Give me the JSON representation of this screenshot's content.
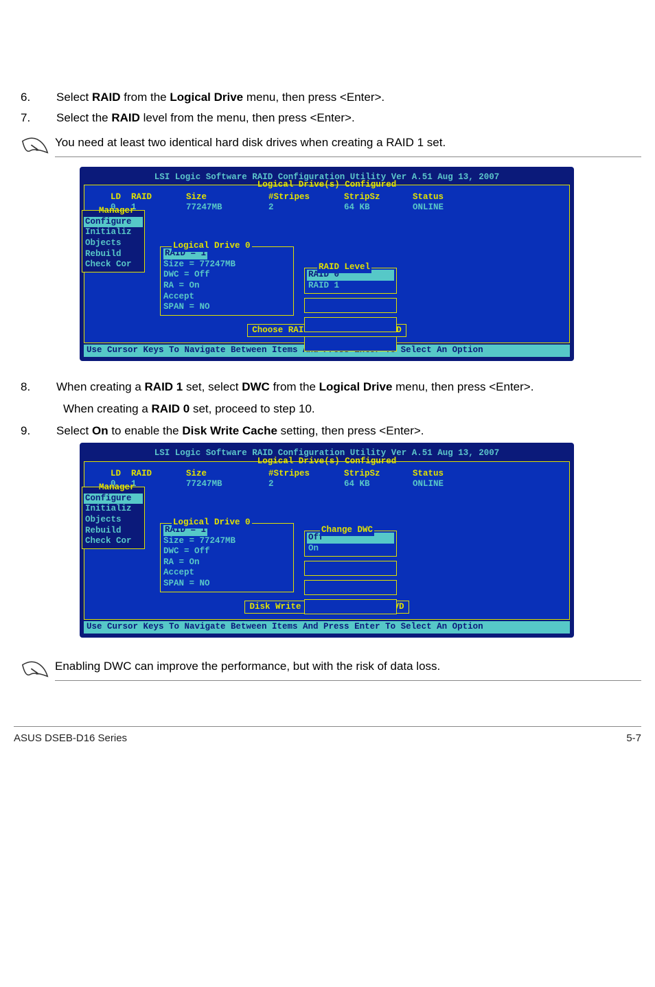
{
  "steps": {
    "s6_num": "6.",
    "s6_text_a": "Select ",
    "s6_b1": "RAID",
    "s6_text_b": " from the ",
    "s6_b2": "Logical Drive",
    "s6_text_c": " menu, then press <Enter>.",
    "s7_num": "7.",
    "s7_text_a": "Select the ",
    "s7_b1": "RAID",
    "s7_text_b": " level from the menu, then press <Enter>.",
    "s8_num": "8.",
    "s8_text_a": "When creating a ",
    "s8_b1": "RAID 1",
    "s8_text_b": " set, select ",
    "s8_b2": "DWC",
    "s8_text_c": " from the ",
    "s8_b3": "Logical Drive",
    "s8_text_d": " menu, then press <Enter>.",
    "s8_sub_a": "When creating a ",
    "s8_sub_b1": "RAID 0",
    "s8_sub_b": " set, proceed to step 10.",
    "s9_num": "9.",
    "s9_text_a": "Select ",
    "s9_b1": "On",
    "s9_text_b": " to enable the ",
    "s9_b2": "Disk Write Cache",
    "s9_text_c": " setting, then press <Enter>."
  },
  "notes": {
    "n1": "You need at least two identical hard disk drives when creating a RAID 1 set.",
    "n2": "Enabling DWC can improve the performance, but with the risk of data loss."
  },
  "bios": {
    "title": "LSI Logic Software RAID Configuration Utility Ver A.51 Aug 13, 2007",
    "panel_title": "Logical Drive(s) Configured",
    "headers": {
      "ld": "LD",
      "raid": "RAID",
      "size": "Size",
      "stripes": "#Stripes",
      "stripsz": "StripSz",
      "status": "Status"
    },
    "row": {
      "ld": "0",
      "raid": "1",
      "size": "77247MB",
      "stripes": "2",
      "stripsz": "64 KB",
      "status": "ONLINE"
    },
    "mgr_label": "Manager",
    "mgr_items": [
      "Configure",
      "Initializ",
      "Objects",
      "Rebuild",
      "Check Cor"
    ],
    "ld_label": "Logical Drive 0",
    "ld_lines": [
      "RAID = 1",
      "Size = 77247MB",
      "DWC  = Off",
      "RA   = On",
      "Accept",
      "SPAN = NO"
    ],
    "rl_label": "RAID Level",
    "rl_opts": [
      "RAID 0",
      "RAID 1"
    ],
    "hint1": "Choose RAID Level For This VD",
    "footer": "Use Cursor Keys To Navigate Between Items And Press Enter To Select An Option",
    "dwc_label": "Change DWC",
    "dwc_opts": [
      "Off",
      "On"
    ],
    "hint2": "Disk Write Cache Setting Of VD"
  },
  "page_footer": {
    "left": "ASUS DSEB-D16 Series",
    "right": "5-7"
  }
}
